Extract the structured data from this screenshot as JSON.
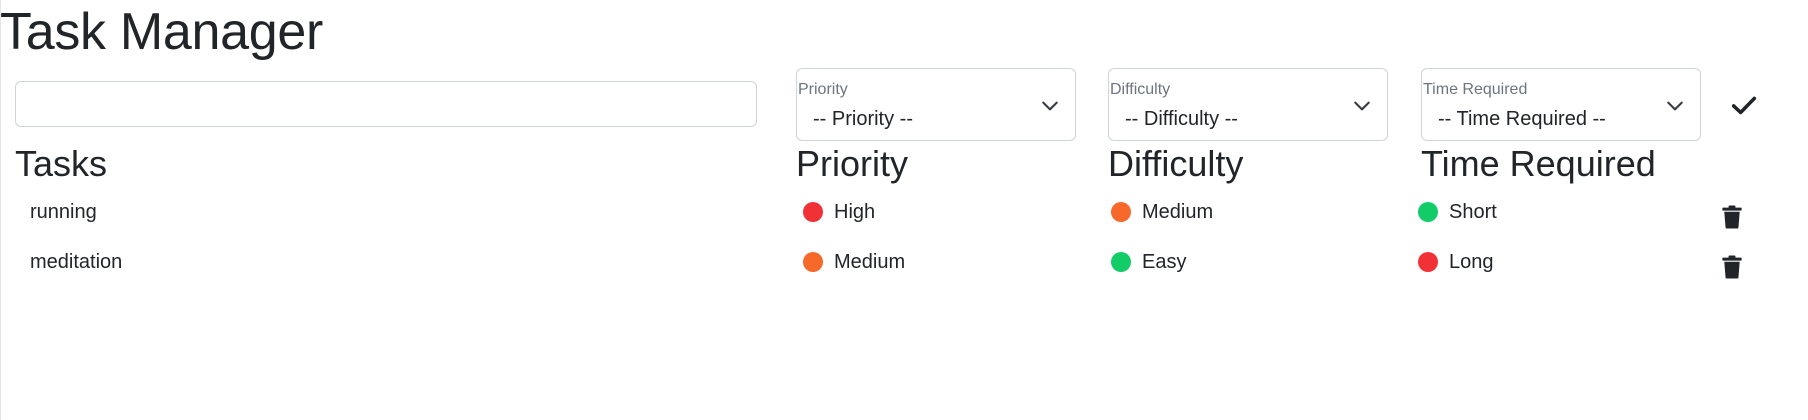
{
  "app": {
    "title": "Task Manager"
  },
  "form": {
    "task_input_value": "",
    "task_input_placeholder": "",
    "priority": {
      "label": "Priority",
      "value": "-- Priority --"
    },
    "difficulty": {
      "label": "Difficulty",
      "value": "-- Difficulty --"
    },
    "time": {
      "label": "Time Required",
      "value": "-- Time Required --"
    },
    "confirm_icon": "check-icon"
  },
  "headers": {
    "tasks": "Tasks",
    "priority": "Priority",
    "difficulty": "Difficulty",
    "time": "Time Required"
  },
  "colors": {
    "red": "#f03237",
    "orange": "#f7692a",
    "green": "#12cc68",
    "text": "#212529"
  },
  "tasks": [
    {
      "name": "running",
      "priority": {
        "label": "High",
        "color": "#f03237"
      },
      "difficulty": {
        "label": "Medium",
        "color": "#f7692a"
      },
      "time": {
        "label": "Short",
        "color": "#12cc68"
      },
      "delete_icon": "trash-icon"
    },
    {
      "name": "meditation",
      "priority": {
        "label": "Medium",
        "color": "#f7692a"
      },
      "difficulty": {
        "label": "Easy",
        "color": "#12cc68"
      },
      "time": {
        "label": "Long",
        "color": "#f03237"
      },
      "delete_icon": "trash-icon"
    }
  ]
}
